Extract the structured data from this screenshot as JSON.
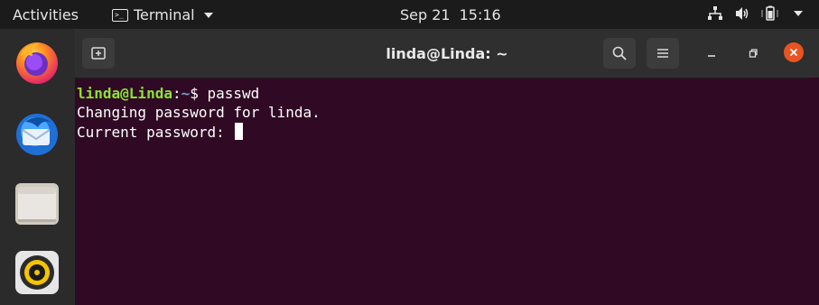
{
  "topbar": {
    "activities": "Activities",
    "app_name": "Terminal",
    "date": "Sep 21",
    "time": "15:16",
    "icons": [
      "network-icon",
      "volume-icon",
      "battery-icon",
      "system-menu-caret-icon"
    ]
  },
  "dock": {
    "items": [
      {
        "name": "firefox",
        "icon": "firefox-icon"
      },
      {
        "name": "thunderbird",
        "icon": "thunderbird-icon"
      },
      {
        "name": "files",
        "icon": "folder-icon"
      },
      {
        "name": "rhythmbox",
        "icon": "rhythmbox-icon"
      }
    ]
  },
  "window": {
    "title": "linda@Linda: ~",
    "buttons": [
      "new-tab-icon",
      "search-icon",
      "menu-icon",
      "minimize-icon",
      "restore-icon",
      "close-icon"
    ]
  },
  "terminal": {
    "prompt_user": "linda@Linda",
    "prompt_sep": ":",
    "prompt_path": "~",
    "prompt_symbol": "$ ",
    "command": "passwd",
    "output_line_1": "Changing password for linda.",
    "output_line_2": "Current password: "
  },
  "colors": {
    "terminal_bg": "#300a24",
    "prompt_user": "#8ae234",
    "prompt_path": "#729fcf",
    "close_button": "#e95420"
  }
}
